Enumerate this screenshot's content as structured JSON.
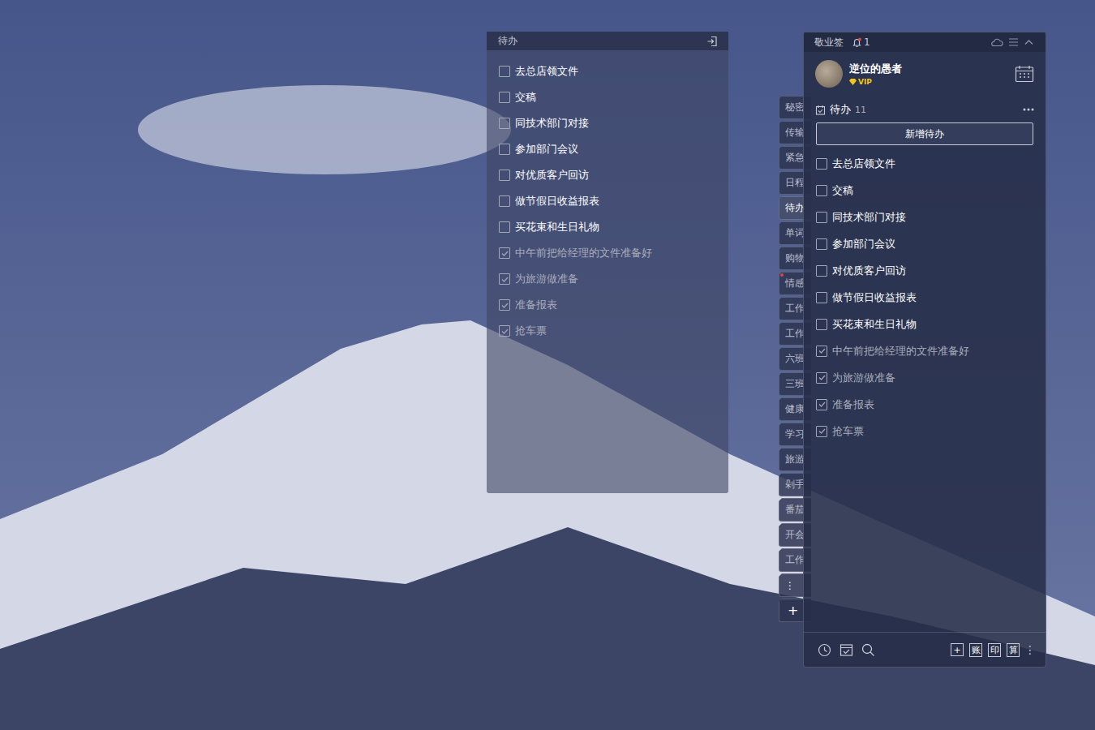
{
  "left_window": {
    "title": "待办",
    "items": [
      {
        "text": "去总店领文件",
        "checked": false
      },
      {
        "text": "交稿",
        "checked": false
      },
      {
        "text": "同技术部门对接",
        "checked": false
      },
      {
        "text": "参加部门会议",
        "checked": false
      },
      {
        "text": "对优质客户回访",
        "checked": false
      },
      {
        "text": "做节假日收益报表",
        "checked": false
      },
      {
        "text": "买花束和生日礼物",
        "checked": false
      },
      {
        "text": "中午前把给经理的文件准备好",
        "checked": true
      },
      {
        "text": "为旅游做准备",
        "checked": true
      },
      {
        "text": "准备报表",
        "checked": true
      },
      {
        "text": "抢车票",
        "checked": true
      }
    ]
  },
  "right_window": {
    "title": "敬业签",
    "notifications": "1",
    "user": {
      "name": "逆位的愚者",
      "badge": "VIP"
    },
    "section": {
      "title": "待办",
      "count": "11"
    },
    "add_button": "新增待办",
    "items": [
      {
        "text": "去总店领文件",
        "checked": false
      },
      {
        "text": "交稿",
        "checked": false
      },
      {
        "text": "同技术部门对接",
        "checked": false
      },
      {
        "text": "参加部门会议",
        "checked": false
      },
      {
        "text": "对优质客户回访",
        "checked": false
      },
      {
        "text": "做节假日收益报表",
        "checked": false
      },
      {
        "text": "买花束和生日礼物",
        "checked": false
      },
      {
        "text": "中午前把给经理的文件准备好",
        "checked": true
      },
      {
        "text": "为旅游做准备",
        "checked": true
      },
      {
        "text": "准备报表",
        "checked": true
      },
      {
        "text": "抢车票",
        "checked": true
      }
    ],
    "footer_buttons": [
      "+",
      "账",
      "印",
      "算"
    ],
    "footer_more": "⋮"
  },
  "side_tabs": [
    {
      "label": "秘密",
      "selected": false,
      "notice": false
    },
    {
      "label": "传输",
      "selected": false,
      "notice": false
    },
    {
      "label": "紧急",
      "selected": false,
      "notice": false
    },
    {
      "label": "日程",
      "selected": false,
      "notice": false
    },
    {
      "label": "待办",
      "selected": true,
      "notice": false
    },
    {
      "label": "单词",
      "selected": false,
      "notice": false
    },
    {
      "label": "购物",
      "selected": false,
      "notice": false
    },
    {
      "label": "情感",
      "selected": false,
      "notice": true
    },
    {
      "label": "工作",
      "selected": false,
      "notice": false
    },
    {
      "label": "工作",
      "selected": false,
      "notice": false
    },
    {
      "label": "六班",
      "selected": false,
      "notice": false
    },
    {
      "label": "三班",
      "selected": false,
      "notice": false
    },
    {
      "label": "健康",
      "selected": false,
      "notice": false
    },
    {
      "label": "学习",
      "selected": false,
      "notice": false
    },
    {
      "label": "旅游",
      "selected": false,
      "notice": false
    },
    {
      "label": "剁手",
      "selected": false,
      "notice": false
    },
    {
      "label": "番茄",
      "selected": false,
      "notice": false
    },
    {
      "label": "开会",
      "selected": false,
      "notice": false
    },
    {
      "label": "工作",
      "selected": false,
      "notice": false
    }
  ],
  "side_tab_controls": [
    "⋮",
    "+"
  ]
}
